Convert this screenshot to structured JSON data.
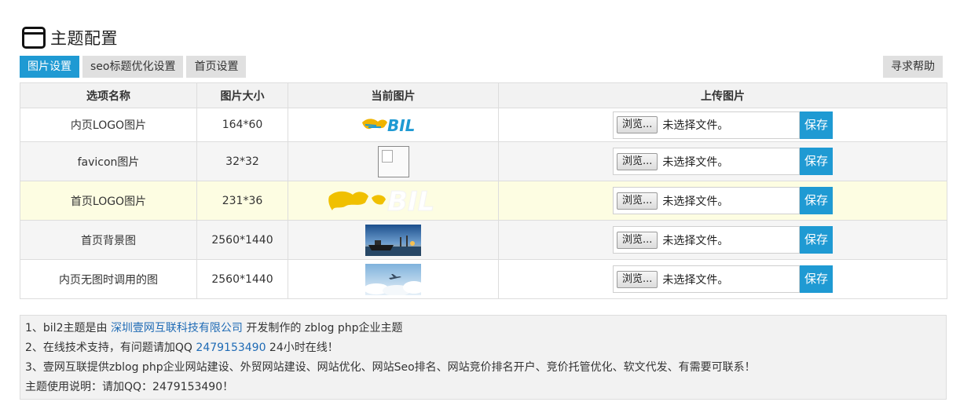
{
  "page": {
    "title": "主题配置",
    "title_icon": "window-icon"
  },
  "tabs": [
    {
      "label": "图片设置",
      "active": true
    },
    {
      "label": "seo标题优化设置",
      "active": false
    },
    {
      "label": "首页设置",
      "active": false
    }
  ],
  "help_button": {
    "label": "寻求帮助"
  },
  "table": {
    "headers": [
      "选项名称",
      "图片大小",
      "当前图片",
      "上传图片"
    ],
    "browse_label": "浏览...",
    "file_status": "未选择文件。",
    "save_label": "保存",
    "rows": [
      {
        "name": "内页LOGO图片",
        "size": "164*60",
        "image": "logo-image"
      },
      {
        "name": "favicon图片",
        "size": "32*32",
        "image": "broken-image"
      },
      {
        "name": "首页LOGO图片",
        "size": "231*36",
        "image": "logo-image-white"
      },
      {
        "name": "首页背景图",
        "size": "2560*1440",
        "image": "ship-harbor-image"
      },
      {
        "name": "内页无图时调用的图",
        "size": "2560*1440",
        "image": "airplane-sky-image"
      }
    ]
  },
  "info": {
    "line1_prefix": "1、bil2主题是由 ",
    "line1_link": "深圳壹网互联科技有限公司",
    "line1_suffix": " 开发制作的 zblog php企业主题",
    "line2_prefix": "2、在线技术支持，有问题请加QQ ",
    "line2_link": "2479153490",
    "line2_suffix": " 24小时在线！",
    "line3": "3、壹网互联提供zblog php企业网站建设、外贸网站建设、网站优化、网站Seo排名、网站竞价排名开户、竞价托管优化、软文代发、有需要可联系！",
    "line4": "主题使用说明：请加QQ：2479153490！"
  },
  "colors": {
    "accent": "#1f9ad3",
    "link": "#1f6bb5",
    "highlight_row": "#fdfde2"
  },
  "logo_text": "BIL"
}
